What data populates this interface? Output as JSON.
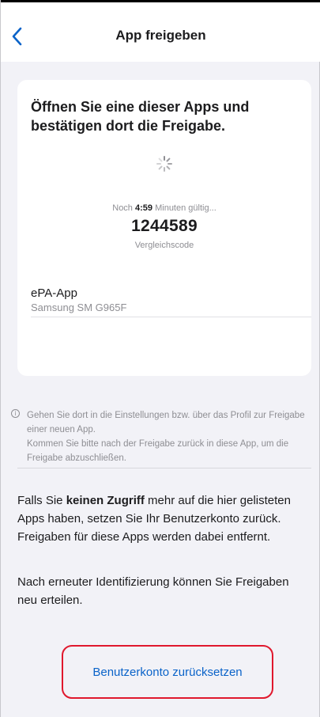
{
  "header": {
    "title": "App freigeben",
    "back_icon": "chevron-left-icon"
  },
  "card": {
    "heading": "Öffnen Sie eine dieser Apps und bestätigen dort die Freigabe.",
    "spinner_icon": "activity-spinner-icon",
    "validity_prefix": "Noch",
    "validity_time": "4:59",
    "validity_suffix": "Minuten gültig...",
    "code": "1244589",
    "code_label": "Vergleichscode",
    "app": {
      "name": "ePA-App",
      "device": "Samsung SM G965F"
    }
  },
  "info": {
    "icon": "info-icon",
    "line1": "Gehen Sie dort in die Einstellungen bzw. über das Profil zur Freigabe einer neuen App.",
    "line2": "Kommen Sie bitte nach der Freigabe zurück in diese App, um die Freigabe abzuschließen."
  },
  "reset_section": {
    "para1_prefix": "Falls Sie",
    "para1_bold": "keinen Zugriff",
    "para1_suffix": "mehr auf die hier gelisteten Apps haben, setzen Sie Ihr Benutzerkonto zurück. Freigaben für diese Apps werden dabei entfernt.",
    "para2": "Nach erneuter Identifizierung können Sie Freigaben neu erteilen.",
    "button_label": "Benutzerkonto zurücksetzen"
  },
  "colors": {
    "accent": "#0a63c9",
    "highlight_border": "#e0182d",
    "background": "#f2f2f7"
  }
}
